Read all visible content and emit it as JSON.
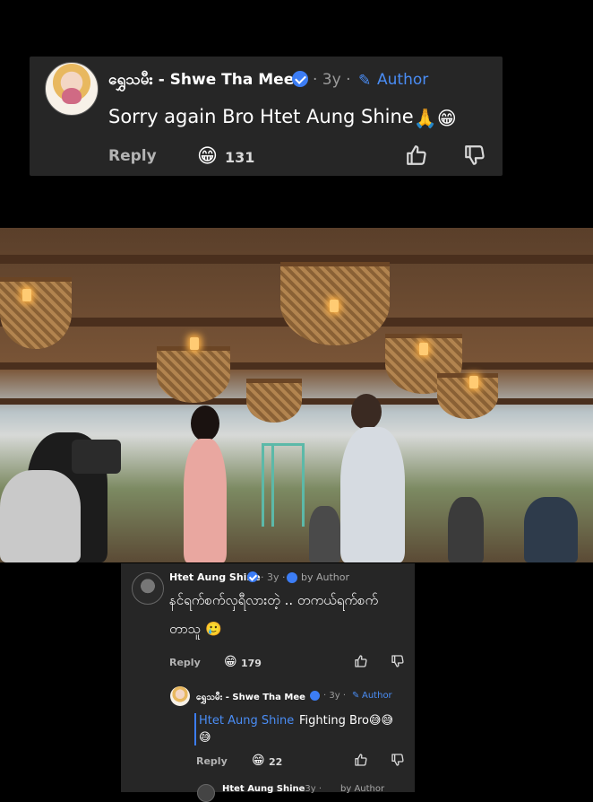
{
  "top_comment": {
    "author": "ရွှေသမီး - Shwe Tha Mee",
    "time": "· 3y ·",
    "author_badge_label": "Author",
    "text": "Sorry again Bro Htet Aung Shine",
    "text_emoji": "🙏😁",
    "reply_label": "Reply",
    "reaction_emoji": "😁",
    "reaction_count": "131"
  },
  "video": {
    "scene": "restaurant-film-set",
    "colors": {
      "roof": "#5a3f2a",
      "basket": "#b2844f",
      "lamp": "#ffcb73"
    }
  },
  "comment2": {
    "author": "Htet Aung Shine",
    "time": "· 3y ·",
    "by_author_label": "by Author",
    "text_line1": "နင်ရက်စက်လှရီလားတဲ့ .. တကယ်ရက်စက်",
    "text_line2": "တာသူ",
    "text_emoji": "🥲",
    "reply_label": "Reply",
    "reaction_emoji": "😁",
    "reaction_count": "179"
  },
  "reply1": {
    "author": "ရွှေသမီး - Shwe Tha Mee",
    "time": "· 3y ·",
    "author_badge_label": "Author",
    "mention": "Htet Aung Shine",
    "text": "Fighting Bro",
    "text_emoji_line1": "😅😅",
    "text_emoji_line2": "😅",
    "reply_label": "Reply",
    "reaction_emoji": "😁",
    "reaction_count": "22"
  },
  "reply2": {
    "author": "Htet Aung Shine",
    "time": "· 3y ·",
    "by_author_label": "by Author"
  },
  "accent_color": "#4a8df5"
}
